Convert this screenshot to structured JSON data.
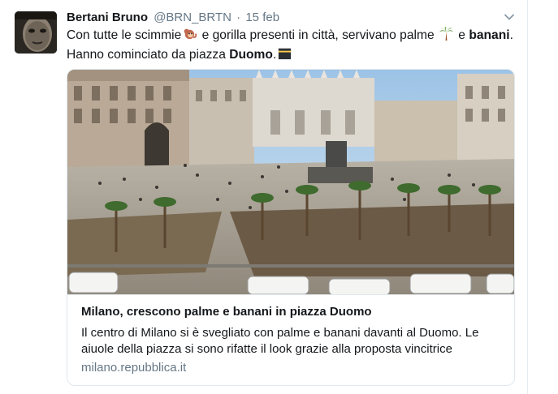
{
  "tweet": {
    "author_name": "Bertani Bruno",
    "author_handle": "@BRN_BRTN",
    "separator": "·",
    "date": "15 feb",
    "text": {
      "line1_a": "Con tutte le scimmie",
      "line1_b": " e gorilla presenti in città, servivano palme ",
      "line1_c": " e ",
      "line1_bold": "banani",
      "line1_end": ".",
      "line2_a": "Hanno cominciato da piazza ",
      "line2_bold": "Duomo",
      "line2_end": "."
    },
    "emojis": [
      "monkey-emoji",
      "palm-tree-emoji",
      "kaaba-emoji"
    ]
  },
  "card": {
    "image_subject": "Piazza Duomo Milano with palm trees and banana plants",
    "title": "Milano, crescono palme e banani in piazza Duomo",
    "description": "Il centro di Milano si è svegliato con palme e banani davanti al Duomo. Le aiuole della piazza si sono rifatte il look grazie alla proposta vincitrice",
    "domain": "milano.repubblica.it"
  },
  "colors": {
    "text": "#14171a",
    "secondary": "#657786",
    "border": "#e1e8ed"
  }
}
